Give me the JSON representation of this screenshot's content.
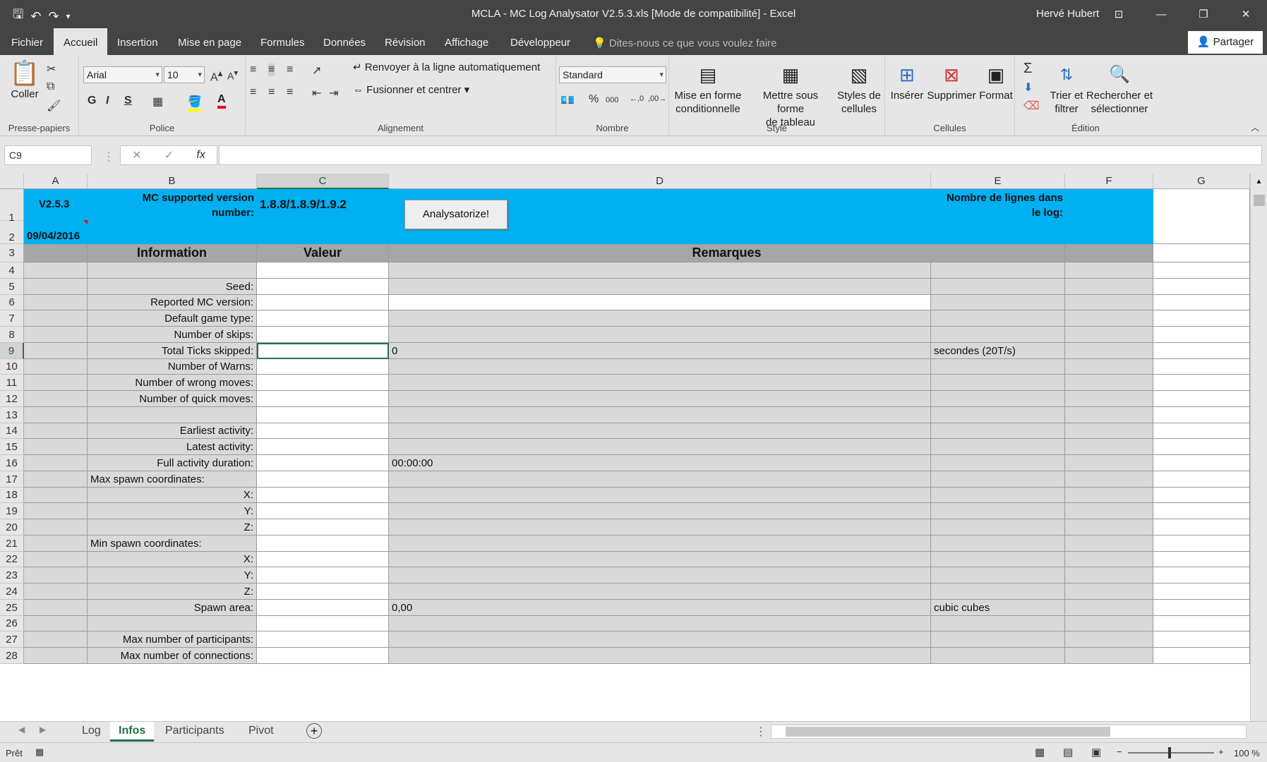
{
  "window": {
    "title": "MCLA - MC Log Analysator V2.5.3.xls  [Mode de compatibilité] - Excel",
    "user": "Hervé Hubert"
  },
  "tabs": [
    "Fichier",
    "Accueil",
    "Insertion",
    "Mise en page",
    "Formules",
    "Données",
    "Révision",
    "Affichage",
    "Développeur"
  ],
  "tell_me": "Dites-nous ce que vous voulez faire",
  "share": "Partager",
  "ribbon": {
    "clipboard": {
      "paste": "Coller",
      "label": "Presse-papiers"
    },
    "font": {
      "name": "Arial",
      "size": "10",
      "bold": "G",
      "italic": "I",
      "underline": "S",
      "label": "Police"
    },
    "alignment": {
      "wrap": "Renvoyer à la ligne automatiquement",
      "merge": "Fusionner et centrer",
      "label": "Alignement"
    },
    "number": {
      "format": "Standard",
      "percent": "%",
      "thousands": "000",
      "label": "Nombre"
    },
    "style": {
      "cond_line1": "Mise en forme",
      "cond_line2": "conditionnelle",
      "table_line1": "Mettre sous forme",
      "table_line2": "de tableau",
      "styles_line1": "Styles de",
      "styles_line2": "cellules",
      "label": "Style"
    },
    "cells": {
      "insert": "Insérer",
      "delete": "Supprimer",
      "format": "Format",
      "label": "Cellules"
    },
    "editing": {
      "sort_line1": "Trier et",
      "sort_line2": "filtrer",
      "find_line1": "Rechercher et",
      "find_line2": "sélectionner",
      "label": "Édition"
    }
  },
  "formula_bar": {
    "namebox": "C9",
    "formula": ""
  },
  "columns": [
    "A",
    "B",
    "C",
    "D",
    "E",
    "F",
    "G"
  ],
  "header_area": {
    "version": "V2.5.3",
    "date": "09/04/2016",
    "mc_label_line1": "MC supported version",
    "mc_label_line2": "number:",
    "mc_versions": "1.8.8/1.8.9/1.9.2",
    "button": "Analysatorize!",
    "lines_label_line1": "Nombre de lignes dans",
    "lines_label_line2": "le log:"
  },
  "table_headers": {
    "info": "Information",
    "value": "Valeur",
    "remarks": "Remarques"
  },
  "rows": [
    {
      "n": "4",
      "info": "",
      "left": false,
      "value": "",
      "remark": "",
      "unit": ""
    },
    {
      "n": "5",
      "info": "Seed:",
      "left": false,
      "value": "",
      "remark": "",
      "unit": ""
    },
    {
      "n": "6",
      "info": "Reported MC version:",
      "left": false,
      "value": "",
      "remark": "",
      "unit": ""
    },
    {
      "n": "7",
      "info": "Default game type:",
      "left": false,
      "value": "",
      "remark": "",
      "unit": ""
    },
    {
      "n": "8",
      "info": "Number of skips:",
      "left": false,
      "value": "",
      "remark": "",
      "unit": ""
    },
    {
      "n": "9",
      "info": "Total Ticks skipped:",
      "left": false,
      "value": "",
      "remark": "0",
      "unit": "secondes (20T/s)"
    },
    {
      "n": "10",
      "info": "Number of Warns:",
      "left": false,
      "value": "",
      "remark": "",
      "unit": ""
    },
    {
      "n": "11",
      "info": "Number of wrong moves:",
      "left": false,
      "value": "",
      "remark": "",
      "unit": ""
    },
    {
      "n": "12",
      "info": "Number of quick moves:",
      "left": false,
      "value": "",
      "remark": "",
      "unit": ""
    },
    {
      "n": "13",
      "info": "",
      "left": false,
      "value": "",
      "remark": "",
      "unit": ""
    },
    {
      "n": "14",
      "info": "Earliest activity:",
      "left": false,
      "value": "",
      "remark": "",
      "unit": ""
    },
    {
      "n": "15",
      "info": "Latest activity:",
      "left": false,
      "value": "",
      "remark": "",
      "unit": ""
    },
    {
      "n": "16",
      "info": "Full activity duration:",
      "left": false,
      "value": "",
      "remark": "00:00:00",
      "unit": ""
    },
    {
      "n": "17",
      "info": "Max spawn coordinates:",
      "left": true,
      "value": "",
      "remark": "",
      "unit": ""
    },
    {
      "n": "18",
      "info": "X:",
      "left": false,
      "value": "",
      "remark": "",
      "unit": ""
    },
    {
      "n": "19",
      "info": "Y:",
      "left": false,
      "value": "",
      "remark": "",
      "unit": ""
    },
    {
      "n": "20",
      "info": "Z:",
      "left": false,
      "value": "",
      "remark": "",
      "unit": ""
    },
    {
      "n": "21",
      "info": "Min spawn coordinates:",
      "left": true,
      "value": "",
      "remark": "",
      "unit": ""
    },
    {
      "n": "22",
      "info": "X:",
      "left": false,
      "value": "",
      "remark": "",
      "unit": ""
    },
    {
      "n": "23",
      "info": "Y:",
      "left": false,
      "value": "",
      "remark": "",
      "unit": ""
    },
    {
      "n": "24",
      "info": "Z:",
      "left": false,
      "value": "",
      "remark": "",
      "unit": ""
    },
    {
      "n": "25",
      "info": "Spawn area:",
      "left": false,
      "value": "",
      "remark": "0,00",
      "unit": "cubic cubes"
    },
    {
      "n": "26",
      "info": "",
      "left": false,
      "value": "",
      "remark": "",
      "unit": ""
    },
    {
      "n": "27",
      "info": "Max number of participants:",
      "left": false,
      "value": "",
      "remark": "",
      "unit": ""
    },
    {
      "n": "28",
      "info": "Max number of connections:",
      "left": false,
      "value": "",
      "remark": "",
      "unit": ""
    }
  ],
  "sheet_tabs": [
    "Log",
    "Infos",
    "Participants",
    "Pivot"
  ],
  "status": {
    "ready": "Prêt",
    "zoom": "100 %"
  },
  "colors": {
    "accent": "#217346",
    "header_blue": "#00b0f0",
    "chrome": "#444444"
  }
}
